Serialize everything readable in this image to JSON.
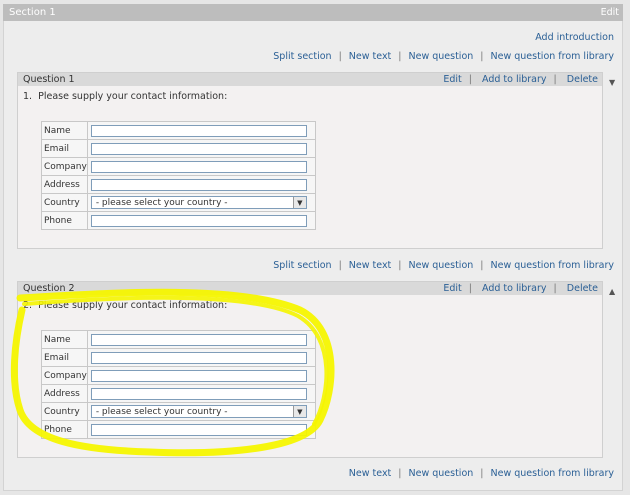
{
  "section": {
    "title": "Section 1",
    "edit_label": "Edit",
    "add_intro_label": "Add introduction"
  },
  "toolbar_top": [
    "Split section",
    "New text",
    "New question",
    "New question from library"
  ],
  "toolbar_mid": [
    "Split section",
    "New text",
    "New question",
    "New question from library"
  ],
  "toolbar_bottom": [
    "New text",
    "New question",
    "New question from library"
  ],
  "questions": [
    {
      "title": "Question 1",
      "actions": [
        "Edit",
        "Add to library",
        "Delete"
      ],
      "number": "1.",
      "text": "Please supply your contact information:",
      "arrow": "▼",
      "fields": [
        {
          "label": "Name",
          "type": "text",
          "value": ""
        },
        {
          "label": "Email",
          "type": "text",
          "value": ""
        },
        {
          "label": "Company",
          "type": "text",
          "value": ""
        },
        {
          "label": "Address",
          "type": "text",
          "value": ""
        },
        {
          "label": "Country",
          "type": "select",
          "value": "- please select your country -"
        },
        {
          "label": "Phone",
          "type": "text",
          "value": ""
        }
      ]
    },
    {
      "title": "Question 2",
      "actions": [
        "Edit",
        "Add to library",
        "Delete"
      ],
      "number": "2.",
      "text": "Please supply your contact information:",
      "arrow": "▲",
      "fields": [
        {
          "label": "Name",
          "type": "text",
          "value": ""
        },
        {
          "label": "Email",
          "type": "text",
          "value": ""
        },
        {
          "label": "Company",
          "type": "text",
          "value": ""
        },
        {
          "label": "Address",
          "type": "text",
          "value": ""
        },
        {
          "label": "Country",
          "type": "select",
          "value": "- please select your country -"
        },
        {
          "label": "Phone",
          "type": "text",
          "value": ""
        }
      ]
    }
  ],
  "colors": {
    "highlight": "#f5f500",
    "link": "#2a5f95"
  }
}
